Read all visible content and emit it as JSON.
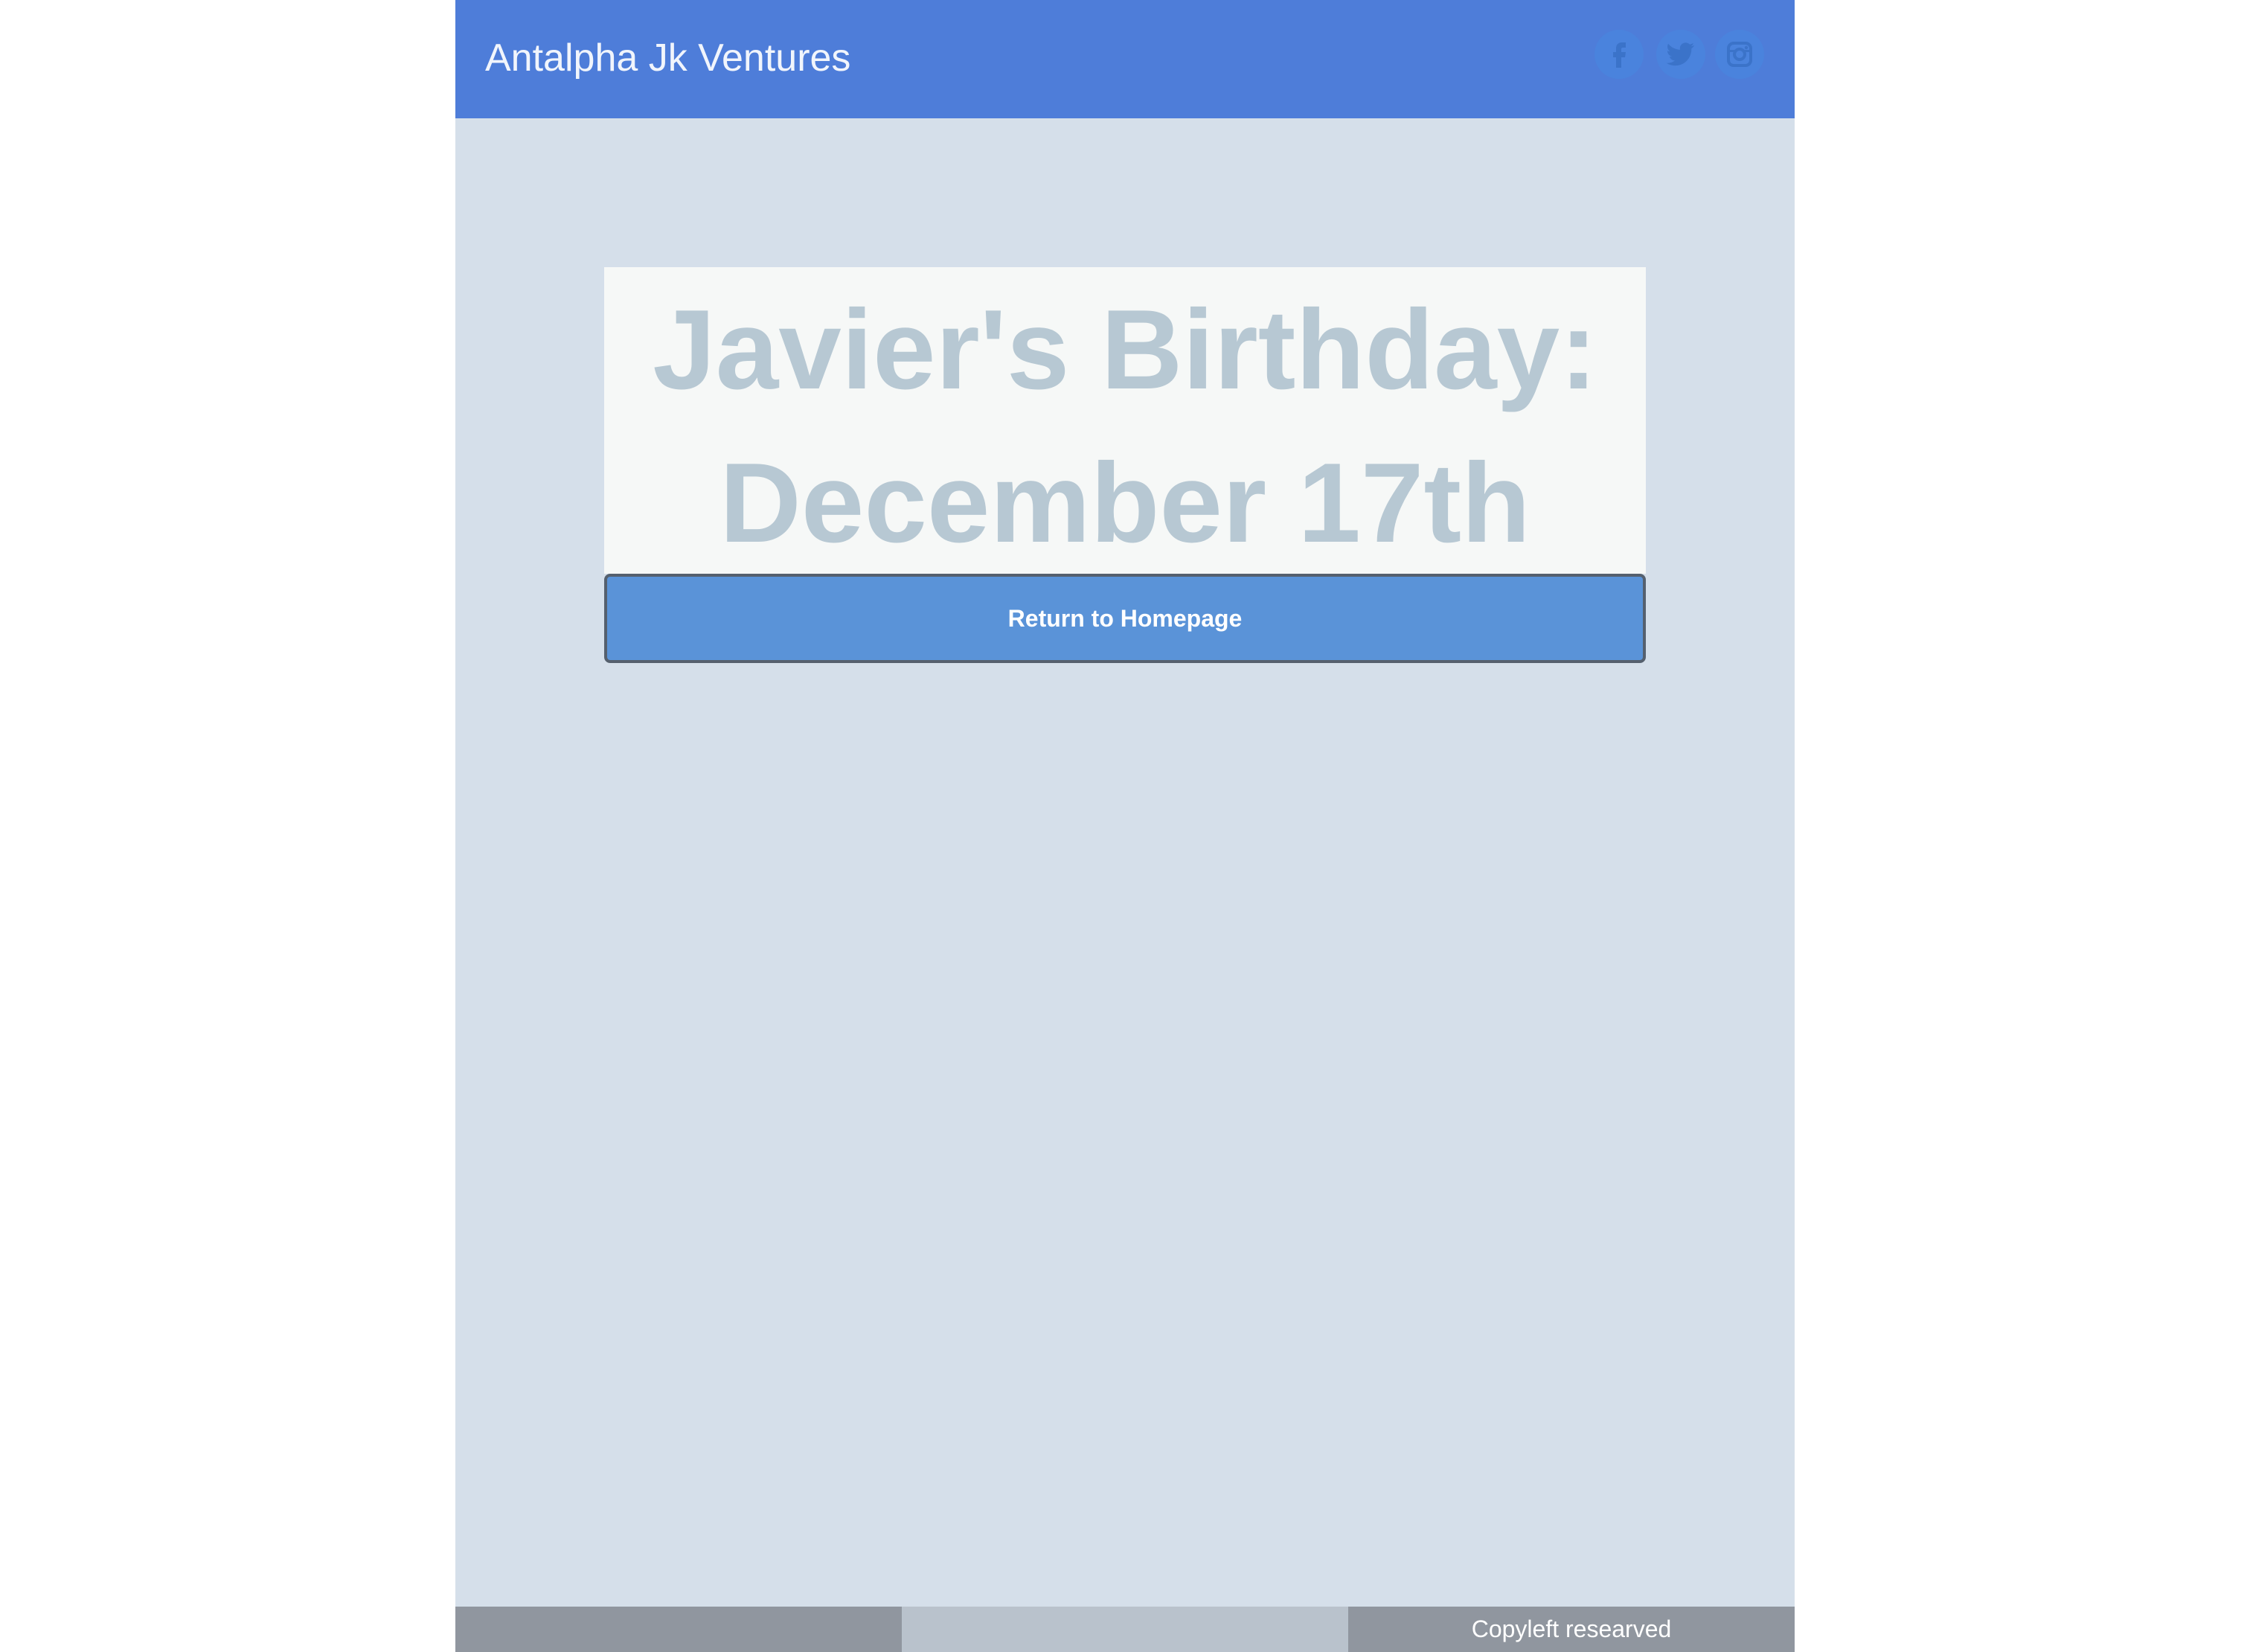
{
  "header": {
    "brand": "Antalpha Jk Ventures",
    "social": [
      {
        "icon": "facebook-icon"
      },
      {
        "icon": "twitter-icon"
      },
      {
        "icon": "instagram-icon"
      }
    ]
  },
  "main": {
    "headline_line1": "Javier's Birthday:",
    "headline_line2": "December 17th",
    "return_button": "Return to Homepage"
  },
  "footer": {
    "copyright": "Copyleft researved"
  },
  "colors": {
    "header_bg": "#4e7dd9",
    "page_bg": "#d5dfea",
    "card_bg": "#f6f8f7",
    "headline": "#b7c8d3",
    "button_bg": "#5a93d8",
    "footer_dark": "#90969f",
    "footer_light": "#b9c2cc"
  }
}
